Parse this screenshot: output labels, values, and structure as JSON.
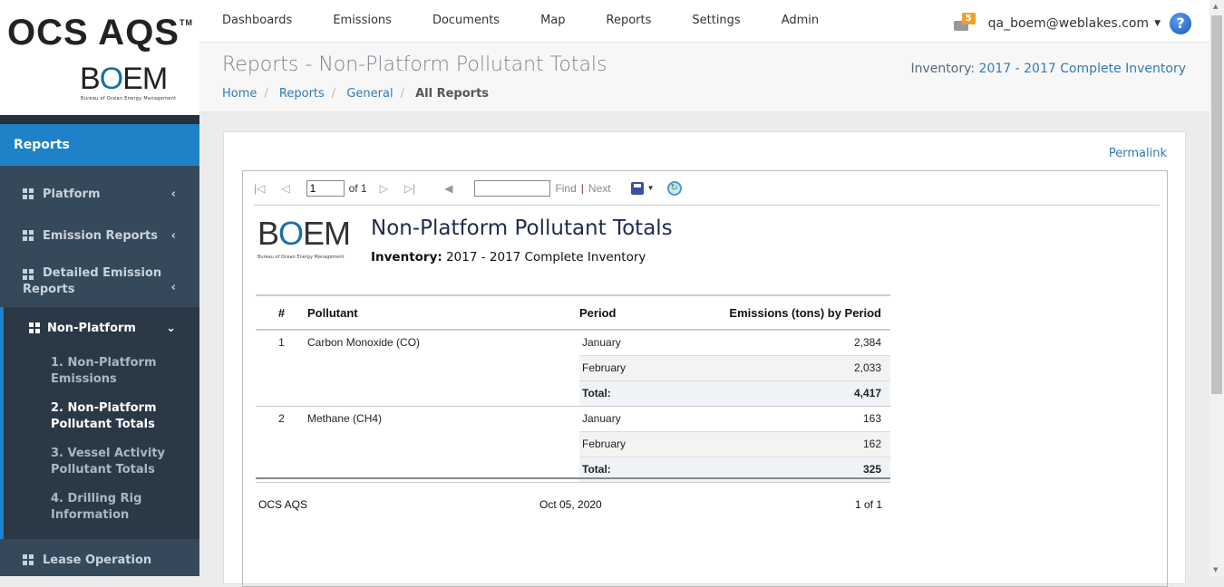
{
  "logo": {
    "app": "OCS AQS",
    "tm": "TM",
    "org": "BOEM",
    "org_full": "Bureau of Ocean Energy Management"
  },
  "sidebar": {
    "section": "Reports",
    "items": [
      {
        "label": "Platform"
      },
      {
        "label": "Emission Reports"
      },
      {
        "label": "Detailed Emission Reports"
      },
      {
        "label": "Non-Platform"
      },
      {
        "label": "Lease Operation"
      }
    ],
    "subitems": [
      {
        "label": "1. Non-Platform Emissions"
      },
      {
        "label": "2. Non-Platform Pollutant Totals"
      },
      {
        "label": "3. Vessel Activity Pollutant Totals"
      },
      {
        "label": "4. Drilling Rig Information"
      }
    ]
  },
  "topnav": [
    "Dashboards",
    "Emissions",
    "Documents",
    "Map",
    "Reports",
    "Settings",
    "Admin"
  ],
  "user": {
    "email": "qa_boem@weblakes.com",
    "mail_count": "5",
    "help": "?"
  },
  "header": {
    "title": "Reports - Non-Platform Pollutant Totals",
    "inventory_label": "Inventory:",
    "inventory_value": "2017 - 2017 Complete Inventory",
    "breadcrumb": [
      "Home",
      "Reports",
      "General",
      "All Reports"
    ]
  },
  "card": {
    "permalink": "Permalink"
  },
  "viewer": {
    "page": "1",
    "of": "of 1",
    "find": "Find",
    "sep": "|",
    "next": "Next",
    "find_value": ""
  },
  "report": {
    "title": "Non-Platform Pollutant Totals",
    "inventory_label": "Inventory:",
    "inventory_value": "2017 - 2017 Complete Inventory",
    "columns": [
      "#",
      "Pollutant",
      "Period",
      "Emissions (tons) by Period"
    ],
    "groups": [
      {
        "num": "1",
        "pollutant": "Carbon Monoxide (CO)",
        "rows": [
          {
            "period": "January",
            "value": "2,384"
          },
          {
            "period": "February",
            "value": "2,033"
          }
        ],
        "total_label": "Total:",
        "total": "4,417"
      },
      {
        "num": "2",
        "pollutant": "Methane (CH4)",
        "rows": [
          {
            "period": "January",
            "value": "163"
          },
          {
            "period": "February",
            "value": "162"
          }
        ],
        "total_label": "Total:",
        "total": "325"
      }
    ],
    "footer": {
      "app": "OCS AQS",
      "date": "Oct 05, 2020",
      "page": "1 of 1"
    }
  }
}
